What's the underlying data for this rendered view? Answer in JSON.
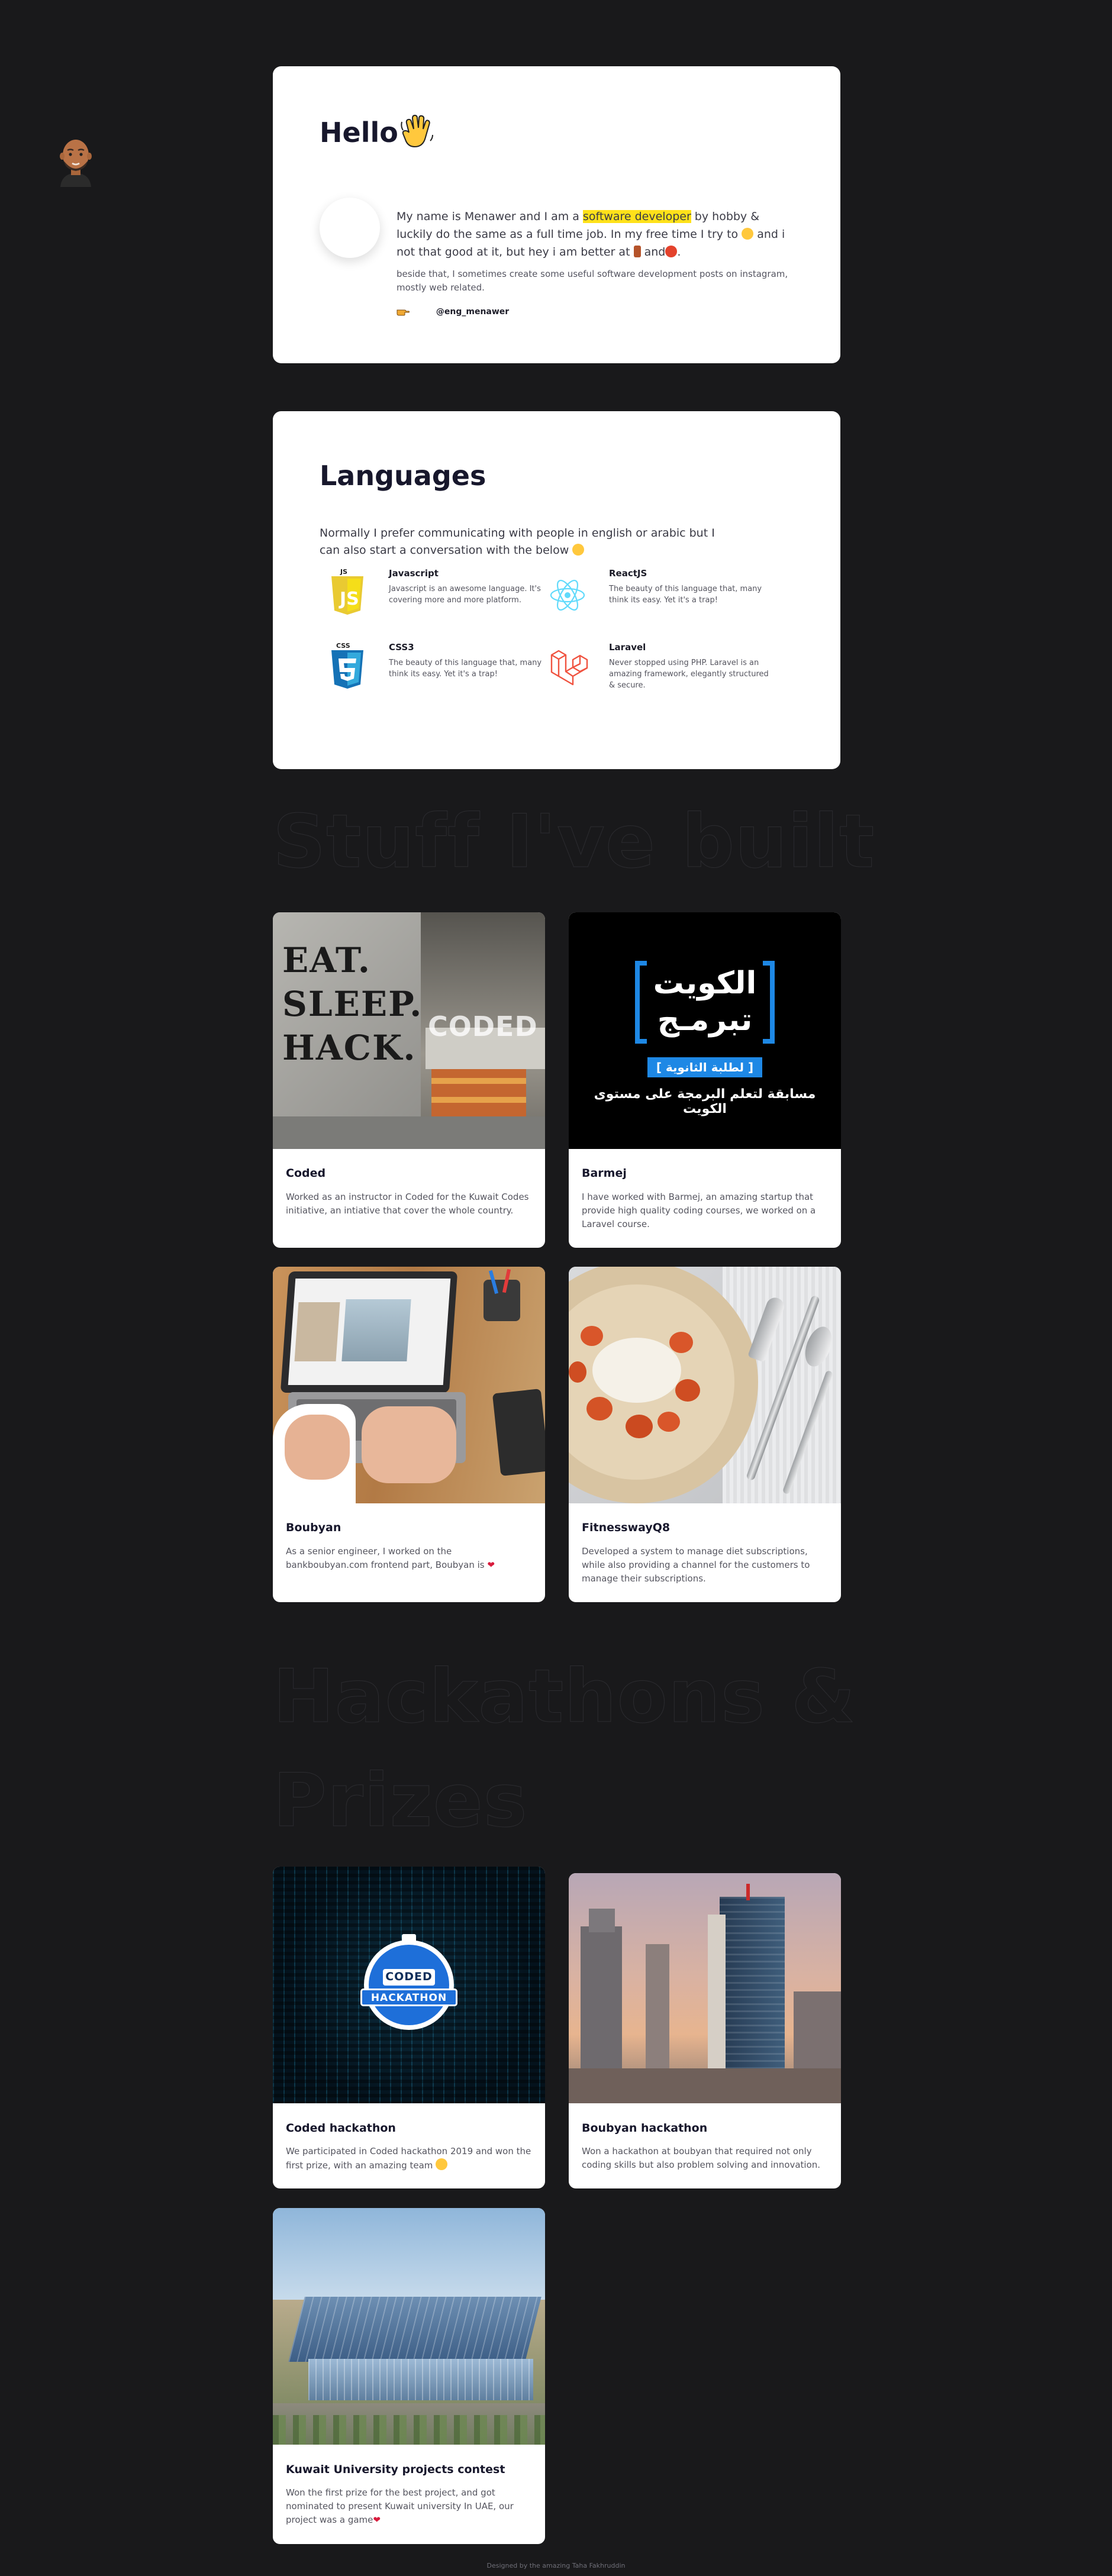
{
  "hello": {
    "title": "Hello",
    "intro_a": "My name is Menawer and I am a ",
    "intro_highlight": "software developer",
    "intro_b": " by hobby & luckily do the same as a full time job. In my free time I try to ",
    "intro_c": " and i not that good at it, but hey i am better at ",
    "intro_d": " and",
    "intro_e": ".",
    "sub": "beside that, I sometimes create some useful software development posts on instagram, mostly web related.",
    "handle": "@eng_menawer"
  },
  "languages": {
    "title": "Languages",
    "lead": "Normally I prefer communicating with people in english or arabic but I can also start a conversation with the below",
    "items": [
      {
        "name": "Javascript",
        "desc": "Javascript is an awesome language. It's covering more and more platform.",
        "icon": "js-icon"
      },
      {
        "name": "ReactJS",
        "desc": "The beauty of this language that, many think its easy. Yet it's a trap!",
        "icon": "react-icon"
      },
      {
        "name": "CSS3",
        "desc": "The beauty of this language that, many think its easy. Yet it's a trap!",
        "icon": "css3-icon"
      },
      {
        "name": "Laravel",
        "desc": "Never stopped using PHP. Laravel is an amazing framework, elegantly structured & secure.",
        "icon": "laravel-icon"
      }
    ]
  },
  "built": {
    "title": "Stuff I've built",
    "projects": [
      {
        "title": "Coded",
        "desc": "Worked as an instructor in Coded for the Kuwait Codes initiative, an intiative that cover the whole country.",
        "img_text": [
          "EAT.",
          "SLEEP.",
          "HACK."
        ],
        "img_sign": "CODED"
      },
      {
        "title": "Barmej",
        "desc": "I have worked with Barmej, an amazing startup that provide high quality coding courses, we worked on a Laravel course.",
        "img_text": [
          "الكويت",
          "تبرمـج",
          "[ لطلبة الثانوية ]",
          "مسابقة لتعلم البرمجة على مستوى الكويت"
        ]
      },
      {
        "title": "Boubyan",
        "desc": "As a senior engineer, I worked on the bankboubyan.com frontend part, Boubyan is"
      },
      {
        "title": "FitnesswayQ8",
        "desc": "Developed a system to manage diet subscriptions, while also providing a channel for the customers to manage their subscriptions."
      }
    ]
  },
  "hackathons": {
    "title": "Hackathons & Prizes",
    "items": [
      {
        "title": "Coded hackathon",
        "desc": "We participated in Coded hackathon 2019 and won the first prize, with an amazing team",
        "img_text": [
          "CODED",
          "HACKATHON"
        ]
      },
      {
        "title": "Boubyan hackathon",
        "desc": "Won a hackathon at boubyan that required not only coding skills but also problem solving and innovation."
      },
      {
        "title": "Kuwait University projects contest",
        "desc": "Won the first prize for the best project, and got nominated to present Kuwait university In UAE, our project was a game"
      }
    ]
  },
  "footer": "Designed by the amazing Taha Fakhruddin",
  "colors": {
    "background": "#19191b",
    "card": "#ffffff",
    "highlight": "#ffe11a",
    "heading": "#17172c"
  }
}
